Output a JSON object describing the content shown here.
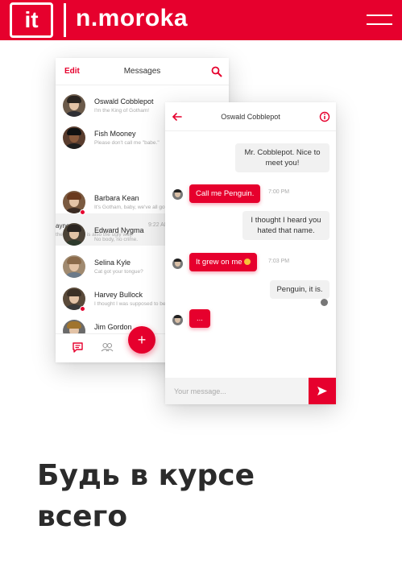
{
  "header": {
    "logo_mark": "it",
    "brand": "n.moroka",
    "menu_icon": "hamburger-icon",
    "accent_color": "#e6002d"
  },
  "messages_list": {
    "edit_label": "Edit",
    "title": "Messages",
    "contacts": [
      {
        "name": "Oswald Cobblepot",
        "preview": "I'm the King of Gotham!"
      },
      {
        "name": "Fish Mooney",
        "preview": "Please don't call me \"babe.\""
      },
      {
        "name": "Barbara Kean",
        "preview": "It's Gotham, baby, we've all got..."
      },
      {
        "name": "Edward Nygma",
        "preview": "No body, no crime."
      },
      {
        "name": "Selina Kyle",
        "preview": "Cat got your tongue?"
      },
      {
        "name": "Harvey Bullock",
        "preview": "I thought I was supposed to be..."
      },
      {
        "name": "Jim Gordon",
        "preview": ""
      }
    ],
    "swiped_row": {
      "name": "ayne",
      "time": "9:22 AM",
      "preview": "the right way is also the ugly way."
    },
    "fab_label": "+"
  },
  "chat": {
    "title": "Oswald Cobblepot",
    "messages": [
      {
        "from": "them",
        "text": "Mr. Cobblepot. Nice to meet you!"
      },
      {
        "from": "me",
        "text": "Call me Penguin.",
        "time": "7:00 PM"
      },
      {
        "from": "them",
        "text": "I thought I heard you hated that name."
      },
      {
        "from": "me",
        "text": "It grew on me",
        "time": "7:03 PM"
      },
      {
        "from": "them",
        "text": "Penguin, it is."
      },
      {
        "from": "me",
        "text": "..."
      }
    ],
    "composer_placeholder": "Your message..."
  },
  "promo": {
    "headline_line1": "Будь в курсе",
    "headline_line2": "всего"
  }
}
